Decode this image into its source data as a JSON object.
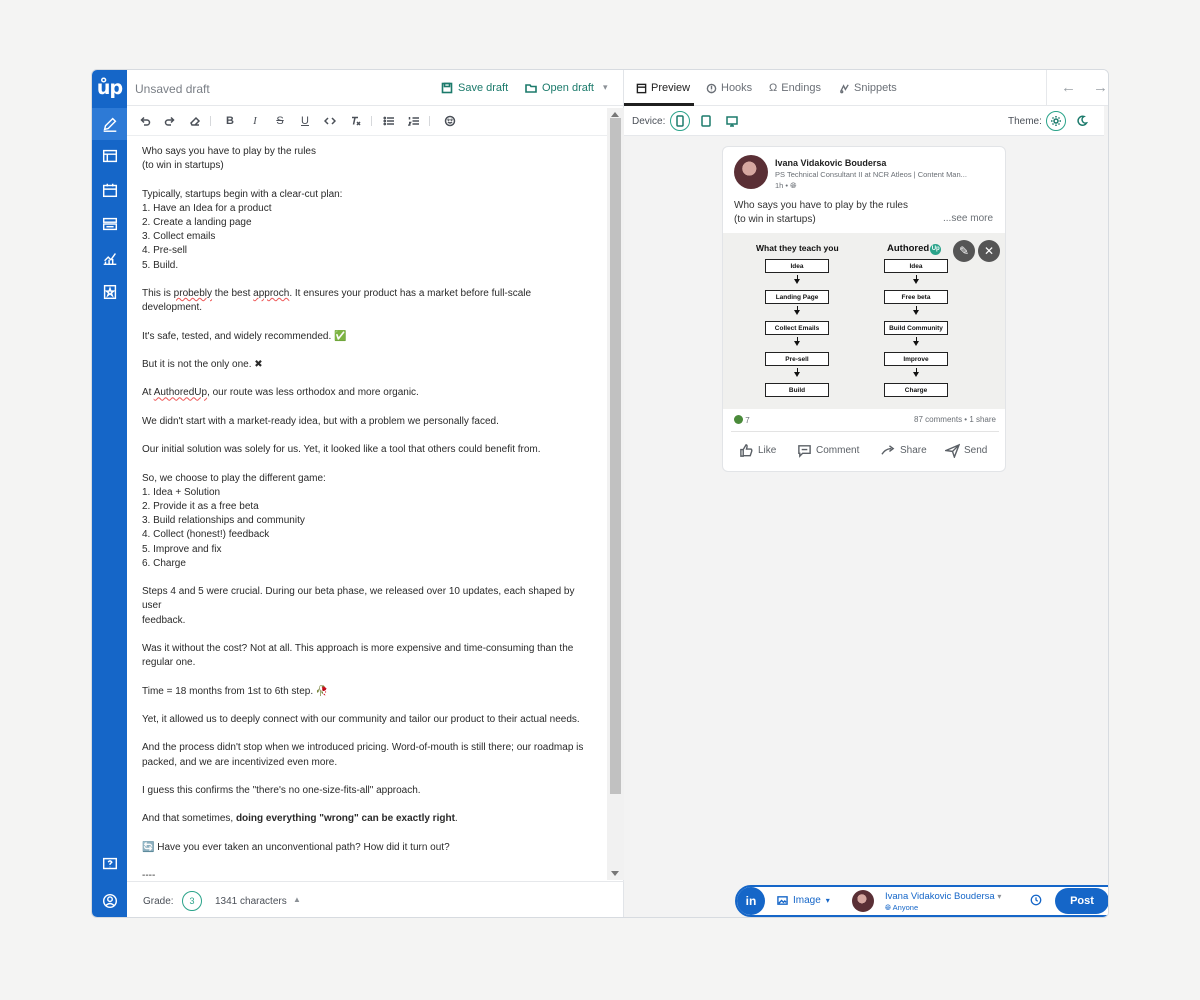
{
  "editor": {
    "draft_title": "Unsaved draft",
    "save_label": "Save draft",
    "open_label": "Open draft",
    "lines": [
      "Who says you have to play by the rules",
      "(to win in startups)",
      "",
      "Typically, startups begin with a clear-cut plan:",
      " 1. Have an Idea for a product",
      " 2. Create a landing page",
      " 3. Collect emails",
      " 4. Pre-sell",
      " 5. Build.",
      "",
      "This is probebly the best approch. It ensures your product has a market before full-scale",
      "development.",
      "",
      "It's safe, tested, and widely recommended. ✅",
      "",
      "But it is not the only one. ✖",
      "",
      "At AuthoredUp, our route was less orthodox and more organic.",
      "",
      "We didn't start with a market-ready idea, but with a problem we personally faced.",
      "",
      "Our initial solution was solely for us. Yet, it looked like a tool that others could benefit from.",
      "",
      "So, we choose to play the different game:",
      " 1. Idea + Solution",
      " 2. Provide it as a free beta",
      " 3. Build relationships and community",
      " 4. Collect (honest!) feedback",
      " 5. Improve and fix",
      " 6. Charge",
      "",
      "Steps 4 and 5 were crucial. During our beta phase, we released over 10 updates, each shaped by user",
      "feedback.",
      "",
      "Was it without the cost? Not at all. This approach is more expensive and time-consuming than the",
      "regular one.",
      "",
      "Time = 18 months from 1st to 6th step. 🥀",
      "",
      "Yet, it allowed us to deeply connect with our community and tailor our product to their actual needs.",
      "",
      "And the process didn't stop when we introduced pricing. Word-of-mouth is still there; our roadmap is",
      "packed, and we are incentivized even more.",
      "",
      "I guess this confirms the \"there's no one-size-fits-all\" approach.",
      "",
      "And that sometimes, doing everything \"wrong\" can be exactly right.",
      "",
      "🔄 Have you ever taken an unconventional path? How did it turn out?",
      "",
      "----"
    ],
    "grade_label": "Grade:",
    "grade_value": "3",
    "char_count": "1341 characters"
  },
  "preview": {
    "tabs": [
      "Preview",
      "Hooks",
      "Endings",
      "Snippets"
    ],
    "device_label": "Device:",
    "theme_label": "Theme:",
    "post": {
      "author": "Ivana Vidakovic Boudersa",
      "headline": "PS Technical Consultant II at NCR Atleos | Content Man...",
      "time": "1h •",
      "text_line1": "Who says you have to play by the rules",
      "text_line2": "(to win in startups)",
      "see_more": "...see more",
      "image": {
        "left_title": "What they teach you",
        "right_title": "Authored",
        "right_logo": "Up",
        "left_steps": [
          "Idea",
          "Landing Page",
          "Collect Emails",
          "Pre-sell",
          "Build"
        ],
        "right_steps": [
          "Idea",
          "Free beta",
          "Build Community",
          "Improve",
          "Charge"
        ]
      },
      "reactions": "7",
      "comments_shares": "87 comments • 1 share",
      "actions": [
        "Like",
        "Comment",
        "Share",
        "Send"
      ]
    }
  },
  "post_bar": {
    "network": "in",
    "media_label": "Image",
    "account_name": "Ivana Vidakovic Boudersa",
    "audience": "Anyone",
    "post_label": "Post"
  },
  "colors": {
    "brand": "#1566c8",
    "accent": "#1b7a6b"
  }
}
